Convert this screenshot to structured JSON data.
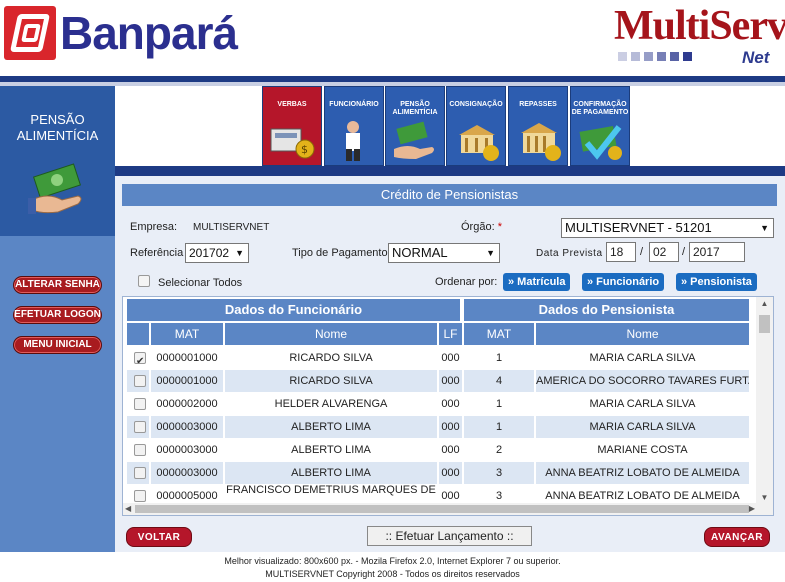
{
  "header": {
    "bank_name": "Banpará",
    "brand_name": "MultiServ",
    "brand_suffix": "Net"
  },
  "sidebar": {
    "title_line1": "PENSÃO",
    "title_line2": "ALIMENTÍCIA",
    "buttons": [
      "ALTERAR SENHA",
      "EFETUAR LOGON",
      "MENU INICIAL"
    ]
  },
  "topnav": {
    "items": [
      {
        "label": "VERBAS",
        "icon": "verbas-icon",
        "active": true
      },
      {
        "label": "FUNCIONÁRIO",
        "icon": "funcionario-icon",
        "active": false
      },
      {
        "label": "PENSÃO ALIMENTÍCIA",
        "icon": "pensao-icon",
        "active": false
      },
      {
        "label": "CONSIGNAÇÃO",
        "icon": "consignacao-icon",
        "active": false
      },
      {
        "label": "REPASSES",
        "icon": "repasses-icon",
        "active": false
      },
      {
        "label": "CONFIRMAÇÃO DE PAGAMENTO",
        "icon": "confirmacao-icon",
        "active": false
      }
    ]
  },
  "form": {
    "title": "Crédito de Pensionistas",
    "empresa_label": "Empresa:",
    "empresa_value": "MULTISERVNET",
    "orgao_label": "Órgão:",
    "orgao_required": "*",
    "orgao_value": "MULTISERVNET - 51201",
    "referencia_label": "Referência",
    "referencia_value": "201702",
    "tipo_pagamento_label": "Tipo de Pagamento",
    "tipo_pagamento_value": "NORMAL",
    "data_prevista_label": "Data Prevista",
    "data_day": "18",
    "data_month": "02",
    "data_year": "2017",
    "date_sep": "/",
    "selecionar_todos": "Selecionar Todos",
    "ordenar_label": "Ordenar por:",
    "ordenar_buttons": [
      "» Matrícula",
      "» Funcionário",
      "» Pensionista"
    ]
  },
  "grid": {
    "group_headers": [
      "Dados do Funcionário",
      "Dados do Pensionista"
    ],
    "columns": [
      "MAT",
      "Nome",
      "LF",
      "MAT",
      "Nome"
    ],
    "rows": [
      {
        "checked": true,
        "mat": "0000001000",
        "nome": "RICARDO SILVA",
        "lf": "000",
        "pmat": "1",
        "pnome": "MARIA CARLA SILVA"
      },
      {
        "checked": false,
        "mat": "0000001000",
        "nome": "RICARDO SILVA",
        "lf": "000",
        "pmat": "4",
        "pnome": "AMERICA DO SOCORRO TAVARES FURTADO"
      },
      {
        "checked": false,
        "mat": "0000002000",
        "nome": "HELDER ALVARENGA",
        "lf": "000",
        "pmat": "1",
        "pnome": "MARIA CARLA SILVA"
      },
      {
        "checked": false,
        "mat": "0000003000",
        "nome": "ALBERTO LIMA",
        "lf": "000",
        "pmat": "1",
        "pnome": "MARIA CARLA SILVA"
      },
      {
        "checked": false,
        "mat": "0000003000",
        "nome": "ALBERTO LIMA",
        "lf": "000",
        "pmat": "2",
        "pnome": "MARIANE COSTA"
      },
      {
        "checked": false,
        "mat": "0000003000",
        "nome": "ALBERTO LIMA",
        "lf": "000",
        "pmat": "3",
        "pnome": "ANNA BEATRIZ LOBATO DE ALMEIDA"
      },
      {
        "checked": false,
        "mat": "0000005000",
        "nome": "FRANCISCO DEMETRIUS MARQUES DE",
        "lf": "000",
        "pmat": "3",
        "pnome": "ANNA BEATRIZ LOBATO DE ALMEIDA"
      }
    ]
  },
  "actions": {
    "voltar": "VOLTAR",
    "efetuar": ":: Efetuar Lançamento ::",
    "avancar": "AVANÇAR"
  },
  "footer": {
    "line1": "Melhor visualizado: 800x600 px. - Mozila Firefox 2.0, Internet Explorer 7 ou superior.",
    "line2": "MULTISERVNET Copyright 2008 - Todos os direitos reservados"
  },
  "colors": {
    "primary_blue": "#1d3a84",
    "light_blue": "#5b86c5",
    "brand_red": "#b5162a"
  }
}
